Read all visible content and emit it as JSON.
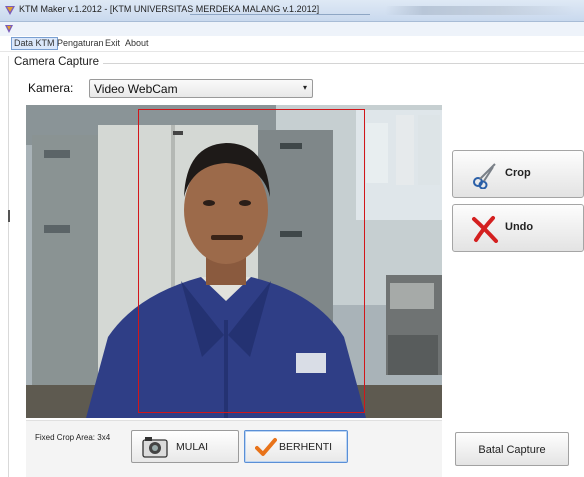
{
  "window": {
    "title": "KTM Maker v.1.2012 - [KTM UNIVERSITAS MERDEKA MALANG v.1.2012]",
    "app_icon": "app-logo-icon"
  },
  "menubar": {
    "items": [
      {
        "label": "Data KTM",
        "active": true
      },
      {
        "label": "Pengaturan",
        "active": false
      },
      {
        "label": "Exit",
        "active": false
      },
      {
        "label": "About",
        "active": false
      }
    ]
  },
  "capture": {
    "group_title": "Camera Capture",
    "kamera_label": "Kamera:",
    "kamera_selected": "Video WebCam",
    "dropdown_icon": "chevron-down-icon"
  },
  "actions": {
    "crop_label": "Crop",
    "crop_icon": "scissors-icon",
    "undo_label": "Undo",
    "undo_icon": "cross-icon"
  },
  "bottom": {
    "fixed_crop_text": "Fixed Crop Area: 3x4",
    "mulai_label": "MULAI",
    "mulai_icon": "camera-icon",
    "berhenti_label": "BERHENTI",
    "berhenti_icon": "checkmark-icon",
    "batal_label": "Batal Capture"
  },
  "colors": {
    "crop_rect": "#d1161a",
    "check": "#e8731a",
    "undo_cross": "#d42020",
    "selection_border": "#5a8fd6"
  }
}
